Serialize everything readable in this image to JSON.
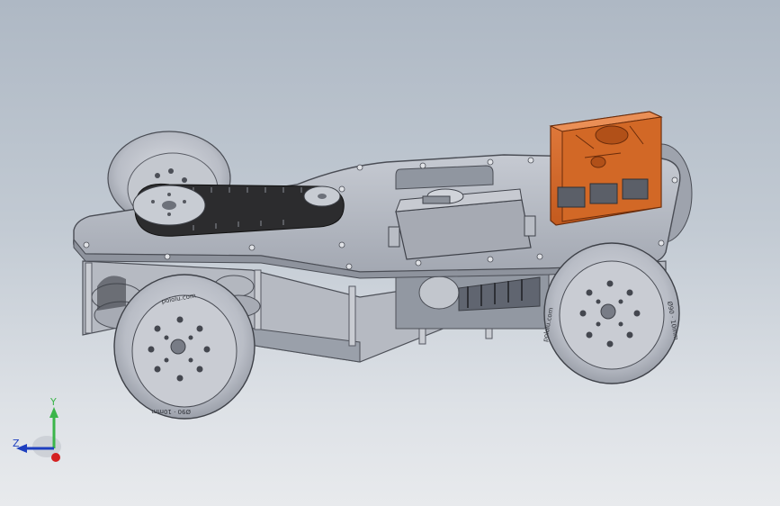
{
  "viewport": {
    "background_top": "#aeb8c4",
    "background_bottom": "#e8eaed"
  },
  "model": {
    "wheel_text_rear_rim": "pololu.com",
    "wheel_text_rear_hub": "Ø90 · 10mm",
    "wheel_text_front_rim": "pololu.com",
    "wheel_text_front_hub": "Ø90 · 10mm",
    "body_color": "#b4b8c0",
    "plate_color": "#a9aeb8",
    "belt_color": "#2c2c2e",
    "board_color": "#d8682a",
    "board_dark": "#a94716"
  },
  "triad": {
    "y_label": "Y",
    "z_label": "Z",
    "y_color": "#3bb54a",
    "z_color": "#1e3fbf",
    "x_color": "#d42020"
  }
}
